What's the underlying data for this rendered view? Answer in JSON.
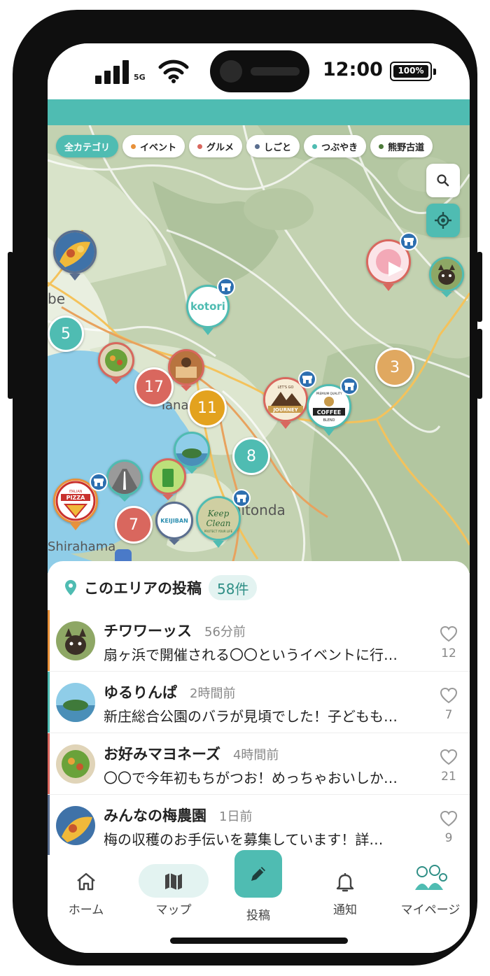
{
  "status_bar": {
    "network": "5G",
    "time": "12:00",
    "battery": "100%"
  },
  "filters": [
    {
      "label": "全カテゴリ",
      "color": "",
      "active": true
    },
    {
      "label": "イベント",
      "color": "#e8913a",
      "active": false
    },
    {
      "label": "グルメ",
      "color": "#d9675e",
      "active": false
    },
    {
      "label": "しごと",
      "color": "#5a6e8f",
      "active": false
    },
    {
      "label": "つぶやき",
      "color": "#4fbcb2",
      "active": false
    },
    {
      "label": "熊野古道",
      "color": "#4d7a3a",
      "active": false
    }
  ],
  "map": {
    "place_labels": [
      "be",
      "Tanabe",
      "Kamitonda",
      "Shirahama"
    ],
    "clusters": [
      "5",
      "17",
      "11",
      "3",
      "8",
      "7"
    ],
    "shop_logos": {
      "kotori": "kotori",
      "journey_top": "LET'S GO",
      "journey": "JOURNEY",
      "coffee_top": "PREMIUM QUALITY",
      "coffee": "COFFEE",
      "coffee_bottom": "BLEND",
      "pizza_top": "ITALIAN",
      "pizza": "PIZZA",
      "keijiban": "KEIJIBAN",
      "keep_clean_1": "Keep",
      "keep_clean_2": "Clean",
      "keep_clean_sub": "PROTECT YOUR LIFE"
    }
  },
  "sheet": {
    "title": "このエリアの投稿",
    "count": "58件"
  },
  "posts": [
    {
      "name": "チワワーッス",
      "time": "56分前",
      "text": "扇ヶ浜で開催される〇〇というイベントに行…",
      "likes": "12",
      "accent": "#e8913a"
    },
    {
      "name": "ゆるりんぱ",
      "time": "2時間前",
      "text": "新庄総合公園のバラが見頃でした！子どもも…",
      "likes": "7",
      "accent": "#4fbcb2"
    },
    {
      "name": "お好みマヨネーズ",
      "time": "4時間前",
      "text": "〇〇で今年初もちがつお！めっちゃおいしか…",
      "likes": "21",
      "accent": "#d9675e"
    },
    {
      "name": "みんなの梅農園",
      "time": "1日前",
      "text": "梅の収穫のお手伝いを募集しています！詳…",
      "likes": "9",
      "accent": "#5a6e8f"
    }
  ],
  "tabs": [
    {
      "label": "ホーム",
      "icon": "home-icon"
    },
    {
      "label": "マップ",
      "icon": "map-icon"
    },
    {
      "label": "投稿",
      "icon": "pencil-icon"
    },
    {
      "label": "通知",
      "icon": "bell-icon"
    },
    {
      "label": "マイページ",
      "icon": "profile-illustration"
    }
  ],
  "colors": {
    "brand": "#4fbcb2",
    "event": "#e8913a",
    "gourmet": "#d9675e",
    "work": "#5a6e8f",
    "tweet": "#4fbcb2",
    "kumano": "#4d7a3a",
    "shop_badge": "#2d6fb0"
  }
}
